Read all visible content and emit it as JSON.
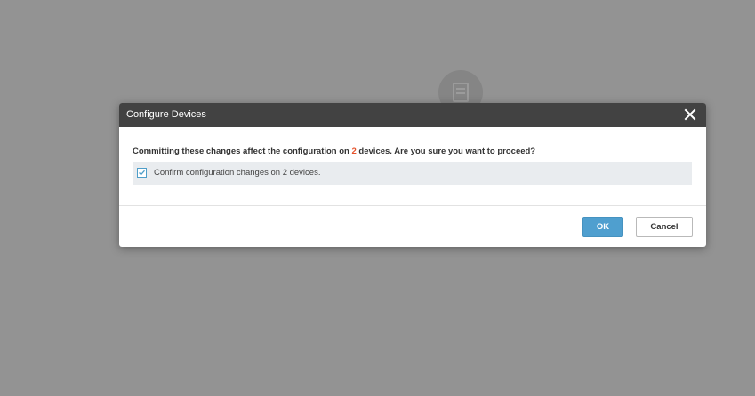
{
  "background": {
    "icon": "document-icon",
    "overlay_color": "#939393"
  },
  "dialog": {
    "title": "Configure Devices",
    "close_icon": "close-icon",
    "message": {
      "before": "Committing these changes affect the configuration on ",
      "count": "2",
      "after": " devices. Are you sure you want to proceed?"
    },
    "confirm_checkbox": {
      "checked": true,
      "label": "Confirm configuration changes on 2 devices."
    },
    "ok_label": "OK",
    "cancel_label": "Cancel"
  },
  "colors": {
    "header_bg": "#424242",
    "accent": "#4f9fcf",
    "count_highlight": "#e5512a",
    "confirm_row_bg": "#e9ecef"
  }
}
